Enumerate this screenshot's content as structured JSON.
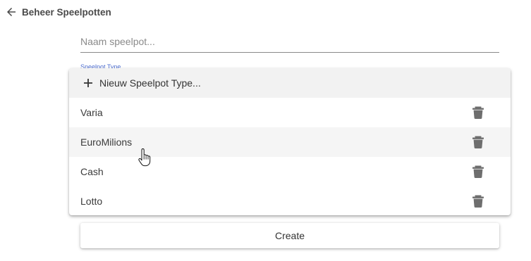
{
  "header": {
    "title": "Beheer Speelpotten",
    "back_icon": "arrow-left-icon"
  },
  "form": {
    "name_placeholder": "Naam speelpot...",
    "name_value": "",
    "type_label": "Speelpot Type"
  },
  "dropdown": {
    "new_type_label": "Nieuw Speelpot Type...",
    "options": [
      {
        "label": "Varia"
      },
      {
        "label": "EuroMilions",
        "hovered": true
      },
      {
        "label": "Cash"
      },
      {
        "label": "Lotto"
      }
    ],
    "delete_icon": "trash-icon"
  },
  "actions": {
    "create_label": "Create"
  },
  "colors": {
    "accent": "#4f6fd1",
    "icon": "#6e6e6e",
    "hover_bg": "#f5f5f5",
    "new_item_bg": "#f2f2f2"
  }
}
